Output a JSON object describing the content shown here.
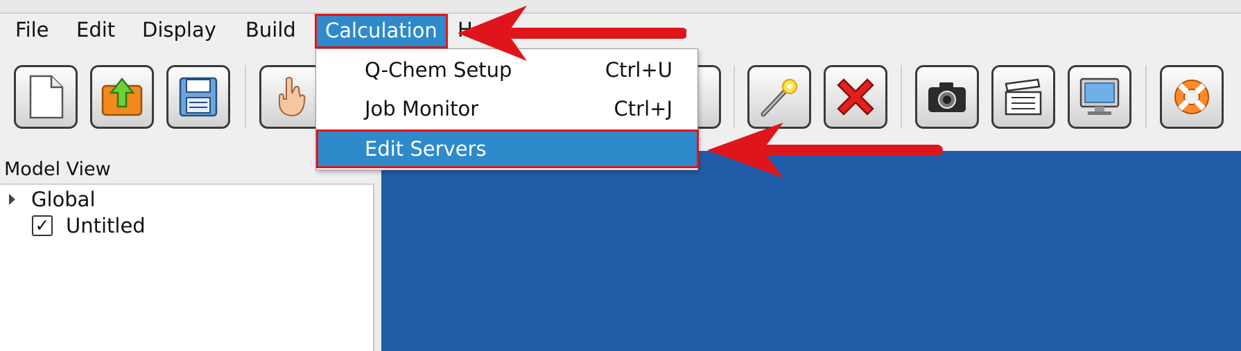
{
  "menubar": {
    "items": [
      {
        "label": "File"
      },
      {
        "label": "Edit"
      },
      {
        "label": "Display"
      },
      {
        "label": "Build"
      },
      {
        "label": "Calculation"
      },
      {
        "label": "H"
      }
    ]
  },
  "calculation_menu": {
    "items": [
      {
        "label": "Q-Chem Setup",
        "shortcut": "Ctrl+U"
      },
      {
        "label": "Job Monitor",
        "shortcut": "Ctrl+J"
      },
      {
        "label": "Edit Servers",
        "shortcut": ""
      }
    ]
  },
  "toolbar": {
    "icons": [
      "new-file-icon",
      "open-file-icon",
      "save-icon",
      "hand-icon",
      "grid-icon",
      "magic-wand-icon",
      "delete-icon",
      "camera-icon",
      "clapperboard-icon",
      "monitor-icon",
      "lifebuoy-icon"
    ]
  },
  "model_view": {
    "title": "Model View",
    "items": [
      {
        "label": "Global"
      },
      {
        "label": "Untitled",
        "checked": true
      }
    ],
    "check_glyph": "✓"
  },
  "colors": {
    "highlight": "#2e8acb",
    "annotation": "#e0151b",
    "viewport": "#215da8"
  }
}
